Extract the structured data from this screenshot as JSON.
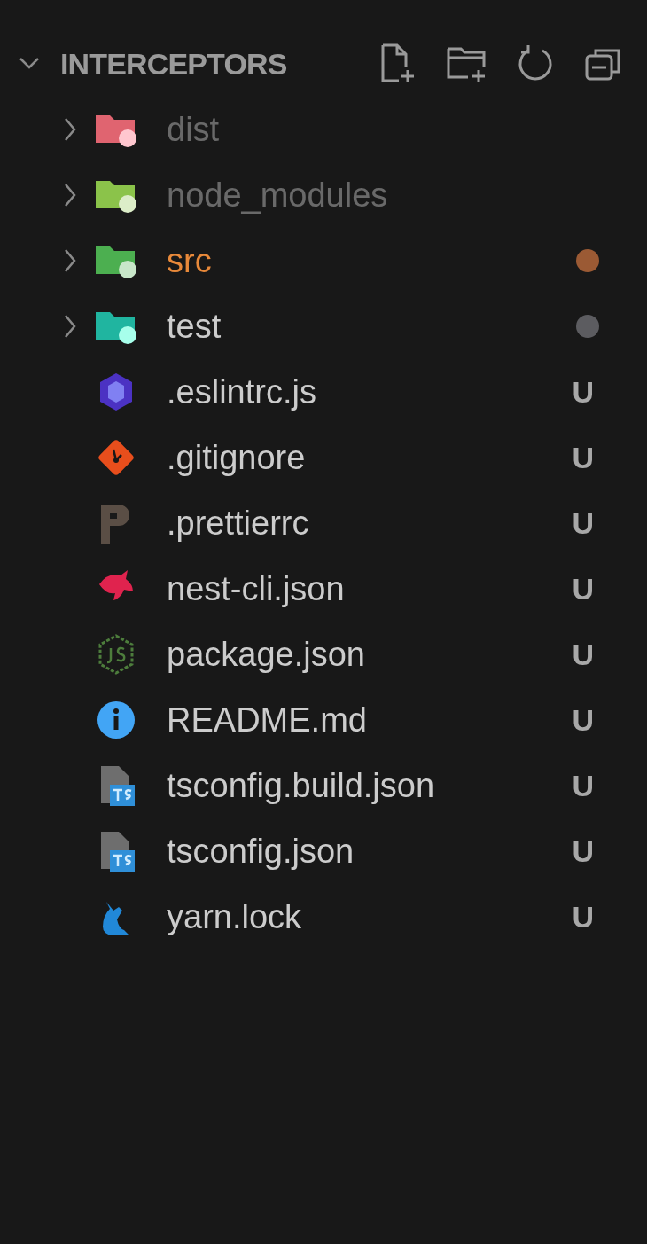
{
  "explorer": {
    "title": "INTERCEPTORS",
    "expanded": true
  },
  "items": [
    {
      "kind": "folder",
      "name": "dist",
      "expanded": false,
      "dimmed": true,
      "highlighted": false
    },
    {
      "kind": "folder",
      "name": "node_modules",
      "expanded": false,
      "dimmed": true,
      "highlighted": false
    },
    {
      "kind": "folder",
      "name": "src",
      "expanded": false,
      "dimmed": false,
      "highlighted": true,
      "color": "#9b5a34"
    },
    {
      "kind": "folder",
      "name": "test",
      "expanded": false,
      "dimmed": false,
      "highlighted": false,
      "color": "#5c5c60"
    },
    {
      "kind": "file",
      "name": ".eslintrc.js",
      "status": "U"
    },
    {
      "kind": "file",
      "name": ".gitignore",
      "status": "U"
    },
    {
      "kind": "file",
      "name": ".prettierrc",
      "status": "U"
    },
    {
      "kind": "file",
      "name": "nest-cli.json",
      "status": "U"
    },
    {
      "kind": "file",
      "name": "package.json",
      "status": "U"
    },
    {
      "kind": "file",
      "name": "README.md",
      "status": "U"
    },
    {
      "kind": "file",
      "name": "tsconfig.build.json",
      "status": "U"
    },
    {
      "kind": "file",
      "name": "tsconfig.json",
      "status": "U"
    },
    {
      "kind": "file",
      "name": "yarn.lock",
      "status": "U"
    }
  ]
}
